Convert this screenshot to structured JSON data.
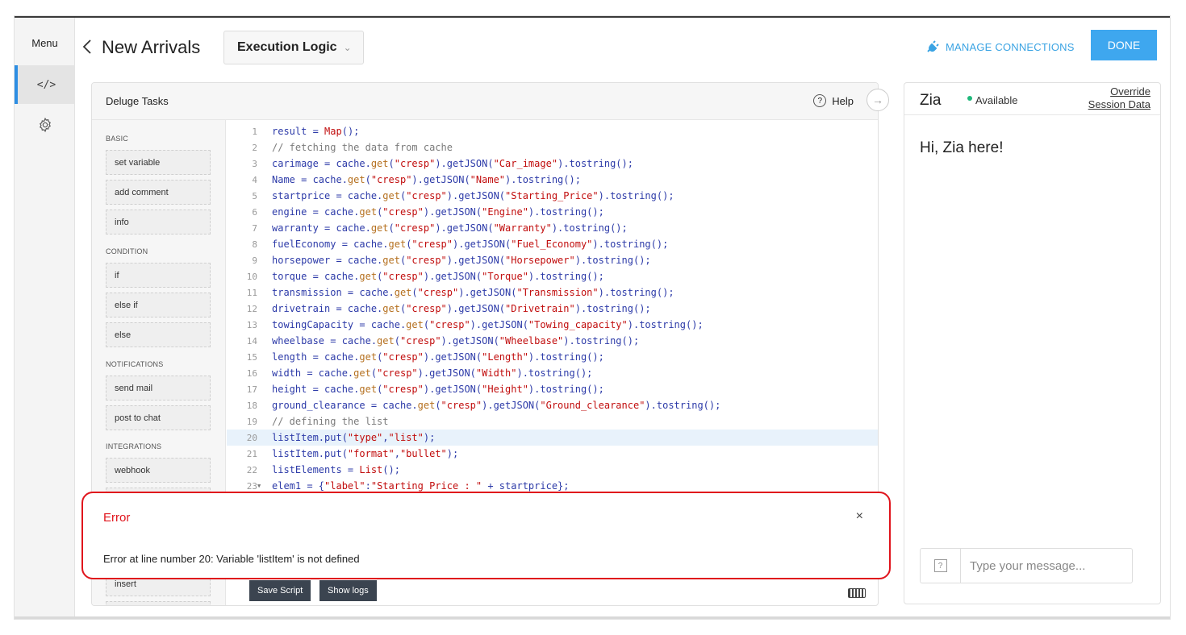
{
  "rail": {
    "menu_label": "Menu",
    "code_icon": "</>"
  },
  "header": {
    "title": "New Arrivals",
    "view_select": "Execution Logic",
    "manage_connections": "MANAGE CONNECTIONS",
    "done": "DONE"
  },
  "panel": {
    "title": "Deluge Tasks",
    "help": "Help",
    "categories": [
      {
        "label": "BASIC",
        "items": [
          "set variable",
          "add comment",
          "info"
        ]
      },
      {
        "label": "CONDITION",
        "items": [
          "if",
          "else if",
          "else"
        ]
      },
      {
        "label": "NOTIFICATIONS",
        "items": [
          "send mail",
          "post to chat"
        ]
      },
      {
        "label": "INTEGRATIONS",
        "items": [
          "webhook"
        ]
      }
    ],
    "hidden_item": "insert"
  },
  "code": {
    "highlighted_line": 20,
    "lines": [
      [
        [
          "t",
          "result = "
        ],
        [
          "s",
          "Map"
        ],
        [
          "t",
          "();"
        ]
      ],
      [
        [
          "c",
          "// fetching the data from cache"
        ]
      ],
      [
        [
          "t",
          "carimage = cache."
        ],
        [
          "k",
          "get"
        ],
        [
          "t",
          "("
        ],
        [
          "s",
          "\"cresp\""
        ],
        [
          "t",
          ").getJSON("
        ],
        [
          "s",
          "\"Car_image\""
        ],
        [
          "t",
          ").tostring();"
        ]
      ],
      [
        [
          "t",
          "Name = cache."
        ],
        [
          "k",
          "get"
        ],
        [
          "t",
          "("
        ],
        [
          "s",
          "\"cresp\""
        ],
        [
          "t",
          ").getJSON("
        ],
        [
          "s",
          "\"Name\""
        ],
        [
          "t",
          ").tostring();"
        ]
      ],
      [
        [
          "t",
          "startprice = cache."
        ],
        [
          "k",
          "get"
        ],
        [
          "t",
          "("
        ],
        [
          "s",
          "\"cresp\""
        ],
        [
          "t",
          ").getJSON("
        ],
        [
          "s",
          "\"Starting_Price\""
        ],
        [
          "t",
          ").tostring();"
        ]
      ],
      [
        [
          "t",
          "engine = cache."
        ],
        [
          "k",
          "get"
        ],
        [
          "t",
          "("
        ],
        [
          "s",
          "\"cresp\""
        ],
        [
          "t",
          ").getJSON("
        ],
        [
          "s",
          "\"Engine\""
        ],
        [
          "t",
          ").tostring();"
        ]
      ],
      [
        [
          "t",
          "warranty = cache."
        ],
        [
          "k",
          "get"
        ],
        [
          "t",
          "("
        ],
        [
          "s",
          "\"cresp\""
        ],
        [
          "t",
          ").getJSON("
        ],
        [
          "s",
          "\"Warranty\""
        ],
        [
          "t",
          ").tostring();"
        ]
      ],
      [
        [
          "t",
          "fuelEconomy = cache."
        ],
        [
          "k",
          "get"
        ],
        [
          "t",
          "("
        ],
        [
          "s",
          "\"cresp\""
        ],
        [
          "t",
          ").getJSON("
        ],
        [
          "s",
          "\"Fuel_Economy\""
        ],
        [
          "t",
          ").tostring();"
        ]
      ],
      [
        [
          "t",
          "horsepower = cache."
        ],
        [
          "k",
          "get"
        ],
        [
          "t",
          "("
        ],
        [
          "s",
          "\"cresp\""
        ],
        [
          "t",
          ").getJSON("
        ],
        [
          "s",
          "\"Horsepower\""
        ],
        [
          "t",
          ").tostring();"
        ]
      ],
      [
        [
          "t",
          "torque = cache."
        ],
        [
          "k",
          "get"
        ],
        [
          "t",
          "("
        ],
        [
          "s",
          "\"cresp\""
        ],
        [
          "t",
          ").getJSON("
        ],
        [
          "s",
          "\"Torque\""
        ],
        [
          "t",
          ").tostring();"
        ]
      ],
      [
        [
          "t",
          "transmission = cache."
        ],
        [
          "k",
          "get"
        ],
        [
          "t",
          "("
        ],
        [
          "s",
          "\"cresp\""
        ],
        [
          "t",
          ").getJSON("
        ],
        [
          "s",
          "\"Transmission\""
        ],
        [
          "t",
          ").tostring();"
        ]
      ],
      [
        [
          "t",
          "drivetrain = cache."
        ],
        [
          "k",
          "get"
        ],
        [
          "t",
          "("
        ],
        [
          "s",
          "\"cresp\""
        ],
        [
          "t",
          ").getJSON("
        ],
        [
          "s",
          "\"Drivetrain\""
        ],
        [
          "t",
          ").tostring();"
        ]
      ],
      [
        [
          "t",
          "towingCapacity = cache."
        ],
        [
          "k",
          "get"
        ],
        [
          "t",
          "("
        ],
        [
          "s",
          "\"cresp\""
        ],
        [
          "t",
          ").getJSON("
        ],
        [
          "s",
          "\"Towing_capacity\""
        ],
        [
          "t",
          ").tostring();"
        ]
      ],
      [
        [
          "t",
          "wheelbase = cache."
        ],
        [
          "k",
          "get"
        ],
        [
          "t",
          "("
        ],
        [
          "s",
          "\"cresp\""
        ],
        [
          "t",
          ").getJSON("
        ],
        [
          "s",
          "\"Wheelbase\""
        ],
        [
          "t",
          ").tostring();"
        ]
      ],
      [
        [
          "t",
          "length = cache."
        ],
        [
          "k",
          "get"
        ],
        [
          "t",
          "("
        ],
        [
          "s",
          "\"cresp\""
        ],
        [
          "t",
          ").getJSON("
        ],
        [
          "s",
          "\"Length\""
        ],
        [
          "t",
          ").tostring();"
        ]
      ],
      [
        [
          "t",
          "width = cache."
        ],
        [
          "k",
          "get"
        ],
        [
          "t",
          "("
        ],
        [
          "s",
          "\"cresp\""
        ],
        [
          "t",
          ").getJSON("
        ],
        [
          "s",
          "\"Width\""
        ],
        [
          "t",
          ").tostring();"
        ]
      ],
      [
        [
          "t",
          "height = cache."
        ],
        [
          "k",
          "get"
        ],
        [
          "t",
          "("
        ],
        [
          "s",
          "\"cresp\""
        ],
        [
          "t",
          ").getJSON("
        ],
        [
          "s",
          "\"Height\""
        ],
        [
          "t",
          ").tostring();"
        ]
      ],
      [
        [
          "t",
          "ground_clearance = cache."
        ],
        [
          "k",
          "get"
        ],
        [
          "t",
          "("
        ],
        [
          "s",
          "\"cresp\""
        ],
        [
          "t",
          ").getJSON("
        ],
        [
          "s",
          "\"Ground_clearance\""
        ],
        [
          "t",
          ").tostring();"
        ]
      ],
      [
        [
          "c",
          "// defining the list"
        ]
      ],
      [
        [
          "t",
          "listItem.put("
        ],
        [
          "s",
          "\"type\""
        ],
        [
          "t",
          ","
        ],
        [
          "s",
          "\"list\""
        ],
        [
          "t",
          ");"
        ]
      ],
      [
        [
          "t",
          "listItem.put("
        ],
        [
          "s",
          "\"format\""
        ],
        [
          "t",
          ","
        ],
        [
          "s",
          "\"bullet\""
        ],
        [
          "t",
          ");"
        ]
      ],
      [
        [
          "t",
          "listElements = "
        ],
        [
          "s",
          "List"
        ],
        [
          "t",
          "();"
        ]
      ],
      [
        [
          "t",
          "elem1 = {"
        ],
        [
          "s",
          "\"label\""
        ],
        [
          "t",
          ":"
        ],
        [
          "s",
          "\"Starting Price : \""
        ],
        [
          "t",
          " + startprice};"
        ]
      ]
    ]
  },
  "footer": {
    "save_script": "Save Script",
    "show_logs": "Show logs"
  },
  "error": {
    "title": "Error",
    "close": "×",
    "message": "Error at line number 20: Variable 'listItem' is not defined"
  },
  "zia": {
    "name": "Zia",
    "status": "Available",
    "override_line1": "Override",
    "override_line2": "Session Data",
    "greeting": "Hi, Zia here!",
    "help_glyph": "?",
    "placeholder": "Type your message..."
  },
  "colors": {
    "accent": "#3ea7ef",
    "error": "#e0141c",
    "status_green": "#1fb87b"
  }
}
